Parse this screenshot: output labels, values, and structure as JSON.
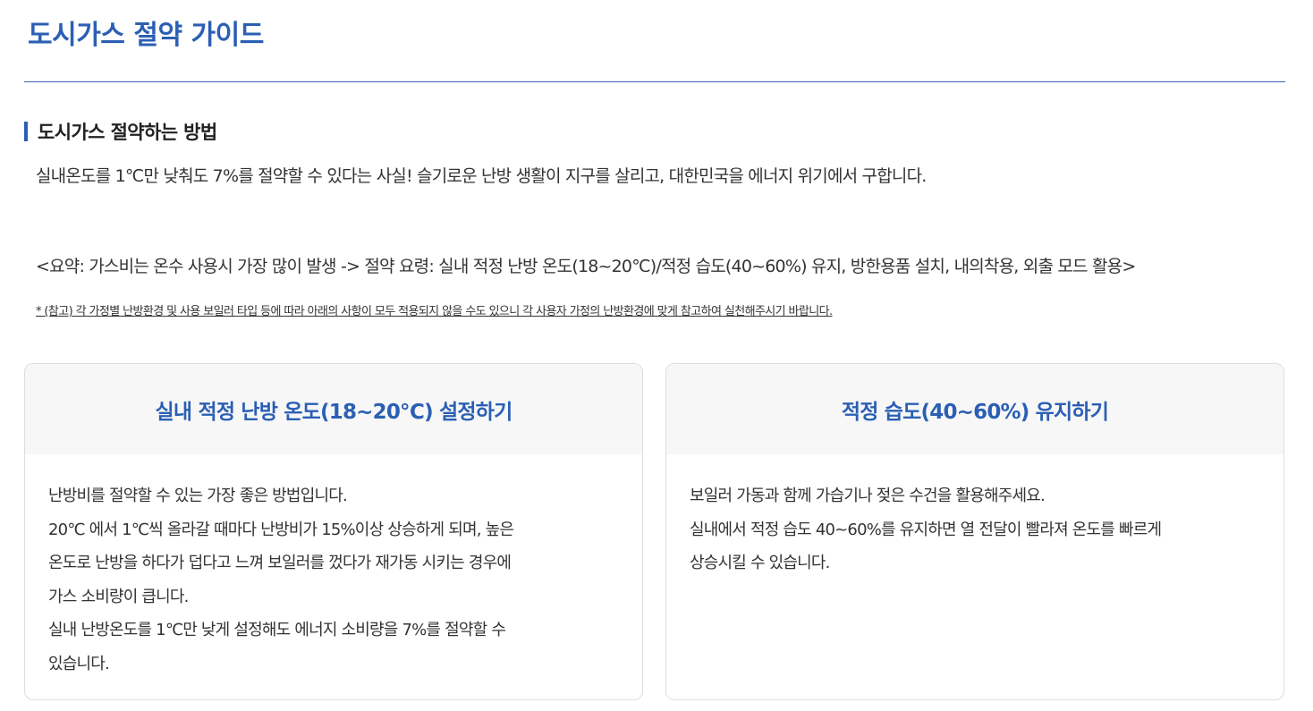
{
  "page": {
    "title": "도시가스 절약 가이드"
  },
  "section": {
    "heading": "도시가스 절약하는 방법",
    "intro": "실내온도를 1℃만 낮춰도 7%를 절약할 수 있다는 사실! 슬기로운 난방 생활이 지구를 살리고, 대한민국을 에너지 위기에서 구합니다.",
    "summary": "<요약: 가스비는 온수 사용시 가장 많이 발생 -> 절약 요령: 실내 적정 난방 온도(18~20℃)/적정 습도(40~60%) 유지, 방한용품 설치, 내의착용, 외출 모드 활용>",
    "note": "* (참고) 각 가정별 난방환경 및 사용 보일러 타입 등에 따라 아래의 사항이 모두 적용되지 않을 수도 있으니 각 사용자 가정의 난방환경에 맞게 참고하여 실천해주시기 바랍니다."
  },
  "cards": [
    {
      "title": "실내 적정 난방 온도(18~20℃) 설정하기",
      "lines": [
        "난방비를 절약할 수 있는 가장 좋은 방법입니다.",
        "20℃ 에서 1℃씩 올라갈 때마다 난방비가 15%이상 상승하게 되며, 높은",
        "온도로 난방을 하다가 덥다고 느껴 보일러를 껐다가 재가동 시키는 경우에",
        "가스 소비량이 큽니다.",
        "실내 난방온도를 1℃만 낮게 설정해도 에너지 소비량을 7%를 절약할 수",
        "있습니다."
      ]
    },
    {
      "title": "적정 습도(40~60%) 유지하기",
      "lines": [
        "보일러 가동과 함께 가습기나 젖은 수건을 활용해주세요.",
        "실내에서 적정 습도 40~60%를 유지하면 열 전달이 빨라져 온도를 빠르게",
        "상승시킬 수 있습니다."
      ]
    }
  ],
  "colors": {
    "accent": "#2b5fb4",
    "card_header_bg": "#f7f7f7",
    "card_border": "#dddddd",
    "text": "#333333"
  }
}
